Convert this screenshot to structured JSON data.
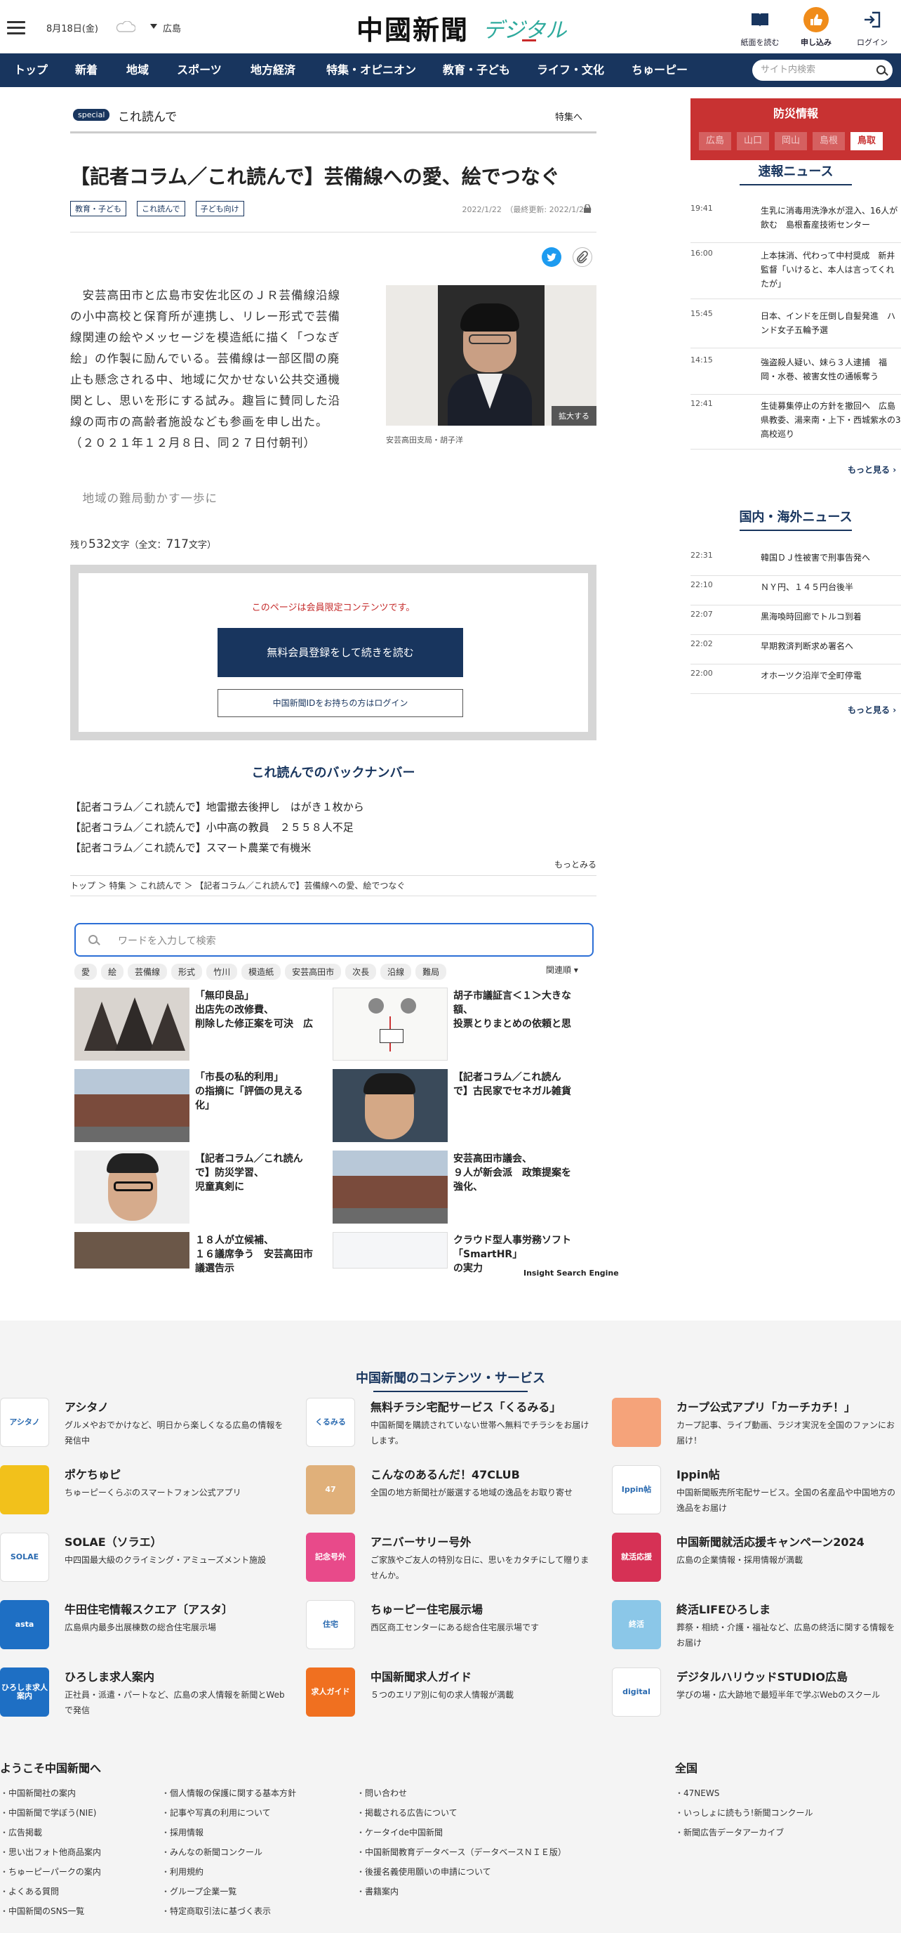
{
  "header": {
    "date": "8月18日(金)",
    "weather_icon": "cloud-icon",
    "area": "広島",
    "logo_main": "中國新聞",
    "logo_sub": "デジタル",
    "buttons": [
      {
        "label": "紙面を読む",
        "icon": "newspaper-icon"
      },
      {
        "label": "申し込み",
        "icon": "thumbs-up-icon"
      },
      {
        "label": "ログイン",
        "icon": "login-icon"
      }
    ]
  },
  "nav": {
    "items": [
      "トップ",
      "新着",
      "地域",
      "スポーツ",
      "地方経済",
      "特集・オピニオン",
      "教育・子ども",
      "ライフ・文化",
      "ちゅーピー"
    ],
    "search_placeholder": "サイト内検索"
  },
  "section": {
    "badge": "special",
    "label": "これ読んで",
    "link": "特集へ"
  },
  "article": {
    "title": "【記者コラム／これ読んで】芸備線への愛、絵でつなぐ",
    "tags": [
      "教育・子ども",
      "これ読んで",
      "子ども向け"
    ],
    "date": "2022/1/22　（最終更新: 2022/1/22）",
    "body_lines": [
      "　安芸高田市と広島市安佐北区のＪＲ芸備線沿線",
      "の小中高校と保育所が連携し、リレー形式で芸備",
      "線関連の絵やメッセージを模造紙に描く「つなぎ",
      "絵」の作製に励んでいる。芸備線は一部区間の廃",
      "止も懸念される中、地域に欠かせない公共交通機",
      "関とし、思いを形にする試み。趣旨に賛同した沿",
      "線の両市の高齢者施設なども参画を申し出た。",
      "（２０２１年１２月８日、同２７日付朝刊）"
    ],
    "faded_line": "　地域の難局動かす一歩に",
    "photo_zoom": "拡大する",
    "photo_caption": "安芸高田支局・胡子洋",
    "remain_prefix": "残り",
    "remain_count": "532",
    "remain_mid": "文字（全文：",
    "total_count": "717",
    "remain_suffix": "文字）"
  },
  "paywall": {
    "message": "このページは会員限定コンテンツです。",
    "register_button": "無料会員登録をして続きを読む",
    "login_button": "中国新聞IDをお持ちの方はログイン"
  },
  "backnumber": {
    "heading": "これ読んでのバックナンバー",
    "items": [
      "【記者コラム／これ読んで】地雷撤去後押し　はがき１枚から",
      "【記者コラム／これ読んで】小中高の教員　２５５８人不足",
      "【記者コラム／これ読んで】スマート農業で有機米"
    ],
    "more": "もっとみる"
  },
  "breadcrumb": "トップ ＞ 特集 ＞ これ読んで ＞ 【記者コラム／これ読んで】芸備線への愛、絵でつなぐ",
  "insight": {
    "placeholder": "ワードを入力して検索",
    "keywords": [
      "愛",
      "絵",
      "芸備線",
      "形式",
      "竹川",
      "模造紙",
      "安芸高田市",
      "次長",
      "沿線",
      "難局"
    ],
    "sort": "関連順",
    "cards": [
      "「無印良品」\n出店先の改修費、\n削除した修正案を可決　広",
      "胡子市議証言＜１＞大きな額、\n投票とりまとめの依頼と思",
      "「市長の私的利用」\nの指摘に「評価の見える\n化」",
      "【記者コラム／これ読ん\nで】古民家でセネガル雑貨",
      "【記者コラム／これ読ん\nで】防災学習、\n児童真剣に",
      "安芸高田市議会、\n９人が新会派　政策提案を\n強化、",
      "１８人が立候補、\n１６議席争う　安芸高田市\n議選告示",
      "クラウド型人事労務ソフト\n「SmartHR」\nの実力"
    ],
    "footer": "Insight Search Engine"
  },
  "sidebar": {
    "disaster_title": "防災情報",
    "prefectures": [
      "広島",
      "山口",
      "岡山",
      "島根",
      "鳥取"
    ],
    "flash_heading": "速報ニュース",
    "flash": [
      {
        "time": "19:41",
        "text": "生乳に消毒用洗浄水が混入、16人が飲む　島根畜産技術センター"
      },
      {
        "time": "16:00",
        "text": "上本抹消、代わって中村奨成　新井監督「いけると、本人は言ってくれたが」"
      },
      {
        "time": "15:45",
        "text": "日本、インドを圧倒し自髪発進　ハンド女子五輪予選"
      },
      {
        "time": "14:15",
        "text": "強盗殺人疑い、妹ら３人逮捕　福岡・水巻、被害女性の通帳奪う"
      },
      {
        "time": "12:41",
        "text": "生徒募集停止の方針を撤回へ　広島県教委、湯来南・上下・西城紫水の3高校巡り"
      }
    ],
    "flash_more": "もっと見る",
    "world_heading": "国内・海外ニュース",
    "world": [
      {
        "time": "22:31",
        "text": "韓国ＤＪ性被害で刑事告発へ"
      },
      {
        "time": "22:10",
        "text": "ＮＹ円、１４５円台後半"
      },
      {
        "time": "22:07",
        "text": "黒海喚時回廊でトルコ到着"
      },
      {
        "time": "22:02",
        "text": "早期救済判断求め署名へ"
      },
      {
        "time": "22:00",
        "text": "オホーツク沿岸で全町停電"
      }
    ],
    "world_more": "もっと見る"
  },
  "footer": {
    "heading": "中国新聞のコンテンツ・サービス",
    "services": [
      {
        "name": "アシタノ",
        "desc": "グルメやおでかけなど、明日から楽しくなる広島の情報を発信中",
        "icon": "アシタノ",
        "color": "#ffffff"
      },
      {
        "name": "無料チラシ宅配サービス「くるみる」",
        "desc": "中国新聞を購読されていない世帯へ無料でチラシをお届けします。",
        "icon": "くるみる",
        "color": "#ffffff"
      },
      {
        "name": "カープ公式アプリ「カーチカチ！」",
        "desc": "カープ記事、ライブ動画、ラジオ実況を全国のファンにお届け！",
        "icon": "",
        "color": "#f5a37a"
      },
      {
        "name": "ポケちゅピ",
        "desc": "ちゅーピーくらぶのスマートフォン公式アプリ",
        "icon": "",
        "color": "#f2c11b"
      },
      {
        "name": "こんなのあるんだ！47CLUB",
        "desc": "全国の地方新聞社が厳選する地域の逸品をお取り寄せ",
        "icon": "47",
        "color": "#e0b07a"
      },
      {
        "name": "Ippin帖",
        "desc": "中国新聞販売所宅配サービス。全国の名産品や中国地方の逸品をお届け",
        "icon": "Ippin帖",
        "color": "#ffffff"
      },
      {
        "name": "SOLAE（ソラエ）",
        "desc": "中四国最大級のクライミング・アミューズメント施設",
        "icon": "SOLAE",
        "color": "#ffffff"
      },
      {
        "name": "アニバーサリー号外",
        "desc": "ご家族やご友人の特別な日に、思いをカタチにして贈りませんか。",
        "icon": "記念号外",
        "color": "#e84a8a"
      },
      {
        "name": "中国新聞就活応援キャンペーン2024",
        "desc": "広島の企業情報・採用情報が満載",
        "icon": "就活応援",
        "color": "#d63155"
      },
      {
        "name": "牛田住宅情報スクエア〔アスタ〕",
        "desc": "広島県内最多出展棟数の総合住宅展示場",
        "icon": "asta",
        "color": "#1e6fc4"
      },
      {
        "name": "ちゅーピー住宅展示場",
        "desc": "西区商工センターにある総合住宅展示場です",
        "icon": "住宅",
        "color": "#ffffff"
      },
      {
        "name": "終活LIFEひろしま",
        "desc": "葬祭・相続・介護・福祉など、広島の終活に関する情報をお届け",
        "icon": "終活",
        "color": "#8bc7e8"
      },
      {
        "name": "ひろしま求人案内",
        "desc": "正社員・派遣・パートなど、広島の求人情報を新聞とWebで発信",
        "icon": "ひろしま求人案内",
        "color": "#1e6fc4"
      },
      {
        "name": "中国新聞求人ガイド",
        "desc": "５つのエリア別に旬の求人情報が満載",
        "icon": "求人ガイド",
        "color": "#f07020"
      },
      {
        "name": "デジタルハリウッドSTUDIO広島",
        "desc": "学びの場・広大跡地で最短半年で学ぶWebのスクール",
        "icon": "digital",
        "color": "#ffffff"
      }
    ],
    "welcome_heading": "ようこそ中国新聞へ",
    "national_heading": "全国",
    "col1": [
      "中国新聞社の案内",
      "中国新聞で学ぼう(NIE)",
      "広告掲載",
      "思い出フォト他商品案内",
      "ちゅーピーパークの案内",
      "よくある質問",
      "中国新聞のSNS一覧"
    ],
    "col2": [
      "個人情報の保護に関する基本方針",
      "記事や写真の利用について",
      "採用情報",
      "みんなの新聞コンクール",
      "利用規約",
      "グループ企業一覧",
      "特定商取引法に基づく表示"
    ],
    "col3": [
      "問い合わせ",
      "掲載される広告について",
      "ケータイde中国新聞",
      "中国新聞教育データベース（データベースＮＩＥ版）",
      "後援名義使用願いの申請について",
      "書籍案内"
    ],
    "col4": [
      "47NEWS",
      "いっしょに読もう!新聞コンクール",
      "新聞広告データアーカイブ"
    ]
  }
}
